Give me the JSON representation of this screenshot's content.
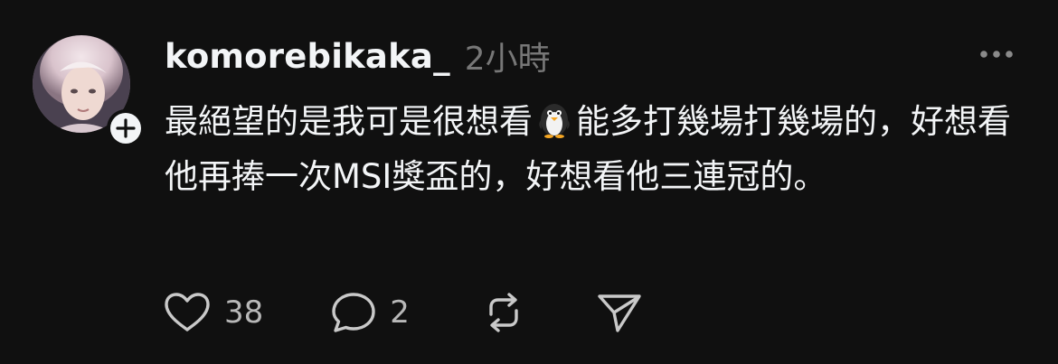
{
  "post": {
    "username": "komorebikaka_",
    "timestamp": "2小時",
    "text_part1": "最絕望的是我可是很想看",
    "text_part2": "能多打幾場打幾場的，好想看他再捧一次MSI獎盃的，好想看他三連冠的。",
    "emoji": "penguin-emoji"
  },
  "actions": {
    "likes": "38",
    "replies": "2"
  },
  "icons": {
    "like": "heart-icon",
    "reply": "comment-icon",
    "repost": "repost-icon",
    "share": "send-icon",
    "more": "more-horizontal-icon",
    "follow": "plus-icon"
  },
  "colors": {
    "background": "#101010",
    "text": "#f3f5f7",
    "muted": "#777777"
  }
}
